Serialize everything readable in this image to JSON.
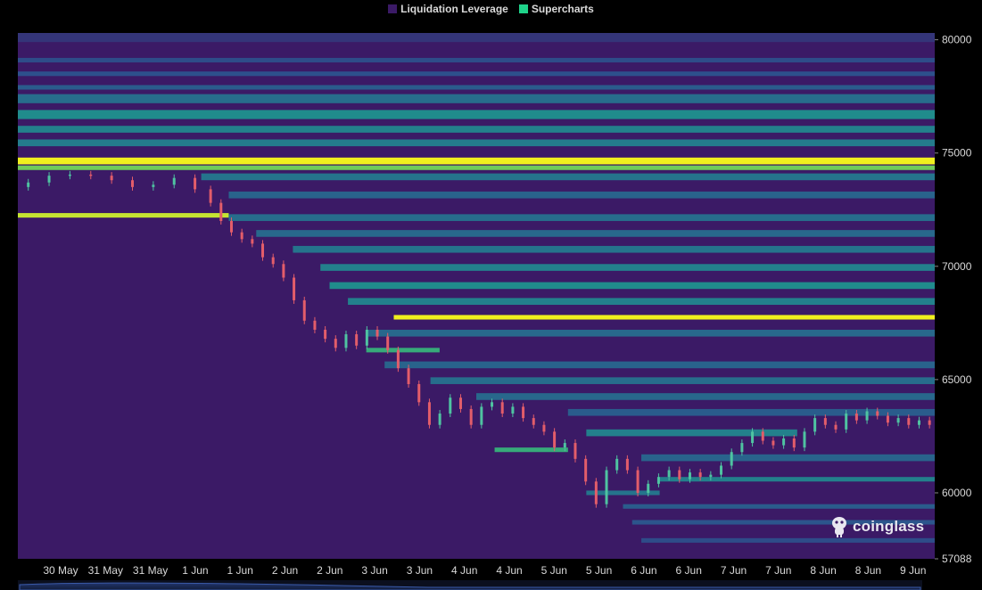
{
  "chart_data": {
    "type": "heatmap",
    "title": "",
    "legend": [
      {
        "name": "Liquidation Leverage",
        "color": "#3b1a66"
      },
      {
        "name": "Supercharts",
        "color": "#1fd38a"
      }
    ],
    "x_tick_labels": [
      "30 May",
      "31 May",
      "31 May",
      "1 Jun",
      "1 Jun",
      "2 Jun",
      "2 Jun",
      "3 Jun",
      "3 Jun",
      "4 Jun",
      "4 Jun",
      "5 Jun",
      "5 Jun",
      "6 Jun",
      "6 Jun",
      "7 Jun",
      "7 Jun",
      "8 Jun",
      "8 Jun",
      "9 Jun"
    ],
    "y_tick_labels": [
      "80000",
      "75000",
      "70000",
      "65000",
      "60000",
      "57088"
    ],
    "y_ticks": [
      80000,
      75000,
      70000,
      65000,
      60000,
      57088
    ],
    "ylim": [
      57088,
      80300
    ],
    "x_range": [
      0,
      20
    ],
    "price_path": [
      [
        0,
        73500
      ],
      [
        1,
        73700
      ],
      [
        2,
        74000
      ],
      [
        3,
        74050
      ],
      [
        4,
        74000
      ],
      [
        5,
        73800
      ],
      [
        6,
        73500
      ],
      [
        7,
        73600
      ],
      [
        8,
        73900
      ],
      [
        9,
        73400
      ],
      [
        9.5,
        72800
      ],
      [
        10,
        72000
      ],
      [
        10.5,
        71500
      ],
      [
        11,
        71200
      ],
      [
        11.5,
        71000
      ],
      [
        12,
        70400
      ],
      [
        12.5,
        70100
      ],
      [
        13,
        69500
      ],
      [
        13.5,
        68500
      ],
      [
        14,
        67600
      ],
      [
        14.5,
        67200
      ],
      [
        15,
        66800
      ],
      [
        15.5,
        66400
      ],
      [
        16,
        67000
      ],
      [
        16.5,
        66500
      ],
      [
        17,
        67200
      ],
      [
        17.5,
        66900
      ],
      [
        18,
        66300
      ],
      [
        18.5,
        65500
      ],
      [
        19,
        64800
      ],
      [
        19.5,
        64000
      ],
      [
        20,
        63000
      ],
      [
        20.5,
        63500
      ],
      [
        21,
        64200
      ],
      [
        21.5,
        63700
      ],
      [
        22,
        63000
      ],
      [
        22.5,
        63800
      ],
      [
        23,
        64000
      ],
      [
        23.5,
        63500
      ],
      [
        24,
        63800
      ],
      [
        24.5,
        63300
      ],
      [
        25,
        63000
      ],
      [
        25.5,
        62700
      ],
      [
        26,
        62000
      ],
      [
        26.5,
        62200
      ],
      [
        27,
        61500
      ],
      [
        27.5,
        60500
      ],
      [
        28,
        59500
      ],
      [
        28.5,
        61000
      ],
      [
        29,
        61500
      ],
      [
        29.5,
        61000
      ],
      [
        30,
        60000
      ],
      [
        30.5,
        60400
      ],
      [
        31,
        60700
      ],
      [
        31.5,
        61000
      ],
      [
        32,
        60600
      ],
      [
        32.5,
        60900
      ],
      [
        33,
        60700
      ],
      [
        33.5,
        60800
      ],
      [
        34,
        61200
      ],
      [
        34.5,
        61800
      ],
      [
        35,
        62200
      ],
      [
        35.5,
        62700
      ],
      [
        36,
        62300
      ],
      [
        36.5,
        62100
      ],
      [
        37,
        62400
      ],
      [
        37.5,
        62000
      ],
      [
        38,
        62700
      ],
      [
        38.5,
        63300
      ],
      [
        39,
        63000
      ],
      [
        39.5,
        62800
      ],
      [
        40,
        63500
      ],
      [
        40.5,
        63200
      ],
      [
        41,
        63600
      ],
      [
        41.5,
        63400
      ],
      [
        42,
        63100
      ],
      [
        42.5,
        63300
      ],
      [
        43,
        63000
      ],
      [
        43.5,
        63200
      ],
      [
        44,
        63000
      ]
    ],
    "bands": [
      {
        "from": 79900,
        "to": 80300,
        "x_start": 0,
        "x_end": 1,
        "intensity": 0.15
      },
      {
        "from": 79000,
        "to": 79200,
        "x_start": 0,
        "x_end": 1,
        "intensity": 0.28
      },
      {
        "from": 78400,
        "to": 78600,
        "x_start": 0,
        "x_end": 1,
        "intensity": 0.3
      },
      {
        "from": 77800,
        "to": 78000,
        "x_start": 0,
        "x_end": 1,
        "intensity": 0.35
      },
      {
        "from": 77200,
        "to": 77600,
        "x_start": 0,
        "x_end": 1,
        "intensity": 0.42
      },
      {
        "from": 76500,
        "to": 76900,
        "x_start": 0,
        "x_end": 1,
        "intensity": 0.55
      },
      {
        "from": 75900,
        "to": 76200,
        "x_start": 0,
        "x_end": 1,
        "intensity": 0.5
      },
      {
        "from": 75300,
        "to": 75600,
        "x_start": 0,
        "x_end": 1,
        "intensity": 0.48
      },
      {
        "from": 74500,
        "to": 74800,
        "x_start": 0,
        "x_end": 1,
        "intensity": 1.0
      },
      {
        "from": 74250,
        "to": 74450,
        "x_start": 0,
        "x_end": 1,
        "intensity": 0.85
      },
      {
        "from": 73800,
        "to": 74100,
        "x_start": 0.2,
        "x_end": 1,
        "intensity": 0.45
      },
      {
        "from": 73000,
        "to": 73300,
        "x_start": 0.23,
        "x_end": 1,
        "intensity": 0.38
      },
      {
        "from": 72150,
        "to": 72350,
        "x_start": 0,
        "x_end": 0.23,
        "intensity": 0.95
      },
      {
        "from": 72000,
        "to": 72300,
        "x_start": 0.23,
        "x_end": 1,
        "intensity": 0.42
      },
      {
        "from": 71300,
        "to": 71600,
        "x_start": 0.26,
        "x_end": 1,
        "intensity": 0.4
      },
      {
        "from": 70600,
        "to": 70900,
        "x_start": 0.3,
        "x_end": 1,
        "intensity": 0.45
      },
      {
        "from": 69800,
        "to": 70100,
        "x_start": 0.33,
        "x_end": 1,
        "intensity": 0.5
      },
      {
        "from": 69000,
        "to": 69300,
        "x_start": 0.34,
        "x_end": 1,
        "intensity": 0.55
      },
      {
        "from": 68300,
        "to": 68600,
        "x_start": 0.36,
        "x_end": 1,
        "intensity": 0.5
      },
      {
        "from": 67650,
        "to": 67850,
        "x_start": 0.41,
        "x_end": 1,
        "intensity": 1.0
      },
      {
        "from": 66900,
        "to": 67200,
        "x_start": 0.38,
        "x_end": 1,
        "intensity": 0.4
      },
      {
        "from": 66200,
        "to": 66400,
        "x_start": 0.38,
        "x_end": 0.46,
        "intensity": 0.7
      },
      {
        "from": 65500,
        "to": 65800,
        "x_start": 0.4,
        "x_end": 1,
        "intensity": 0.38
      },
      {
        "from": 64800,
        "to": 65100,
        "x_start": 0.45,
        "x_end": 1,
        "intensity": 0.42
      },
      {
        "from": 64100,
        "to": 64400,
        "x_start": 0.5,
        "x_end": 1,
        "intensity": 0.4
      },
      {
        "from": 63400,
        "to": 63700,
        "x_start": 0.6,
        "x_end": 1,
        "intensity": 0.35
      },
      {
        "from": 62500,
        "to": 62800,
        "x_start": 0.62,
        "x_end": 0.85,
        "intensity": 0.5
      },
      {
        "from": 61800,
        "to": 62000,
        "x_start": 0.52,
        "x_end": 0.6,
        "intensity": 0.7
      },
      {
        "from": 61400,
        "to": 61700,
        "x_start": 0.68,
        "x_end": 1,
        "intensity": 0.38
      },
      {
        "from": 60500,
        "to": 60700,
        "x_start": 0.7,
        "x_end": 1,
        "intensity": 0.5
      },
      {
        "from": 59900,
        "to": 60100,
        "x_start": 0.62,
        "x_end": 0.7,
        "intensity": 0.45
      },
      {
        "from": 59300,
        "to": 59500,
        "x_start": 0.66,
        "x_end": 1,
        "intensity": 0.35
      },
      {
        "from": 58600,
        "to": 58800,
        "x_start": 0.67,
        "x_end": 1,
        "intensity": 0.32
      },
      {
        "from": 57800,
        "to": 58000,
        "x_start": 0.68,
        "x_end": 1,
        "intensity": 0.28
      }
    ]
  },
  "brand": {
    "name": "coinglass"
  }
}
